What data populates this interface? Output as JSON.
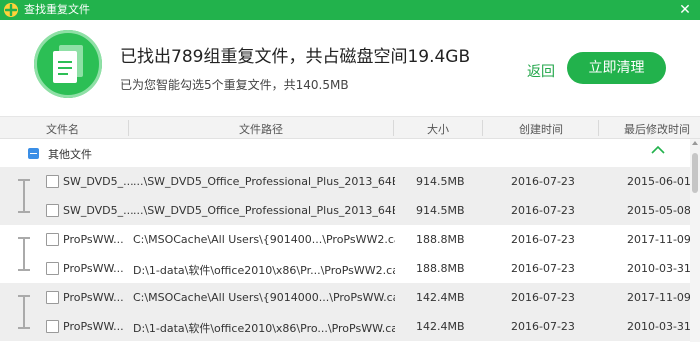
{
  "window": {
    "title": "查找重复文件",
    "close_glyph": "✕"
  },
  "header": {
    "headline": "已找出789组重复文件，共占磁盘空间19.4GB",
    "subline": "已为您智能勾选5个重复文件，共140.5MB",
    "back_label": "返回",
    "clean_label": "立即清理",
    "accent_color": "#22b24c"
  },
  "columns": [
    "文件名",
    "文件路径",
    "大小",
    "创建时间",
    "最后修改时间"
  ],
  "group": {
    "label": "其他文件",
    "collapse_icon": "chevron-up-icon"
  },
  "duplicate_groups": [
    {
      "rows": [
        {
          "name": "SW_DVD5_...",
          "path": "...\\SW_DVD5_Office_Professional_Plus_2013_64Bit_...",
          "size": "914.5MB",
          "created": "2016-07-23",
          "modified": "2015-06-01",
          "checked": false
        },
        {
          "name": "SW_DVD5_...",
          "path": "...\\SW_DVD5_Office_Professional_Plus_2013_64Bit_...",
          "size": "914.5MB",
          "created": "2016-07-23",
          "modified": "2015-05-08",
          "checked": false
        }
      ]
    },
    {
      "rows": [
        {
          "name": "ProPsWW...",
          "path": "C:\\MSOCache\\All Users\\{901400...\\ProPsWW2.cab",
          "size": "188.8MB",
          "created": "2016-07-23",
          "modified": "2017-11-09",
          "checked": false
        },
        {
          "name": "ProPsWW...",
          "path": "D:\\1-data\\软件\\office2010\\x86\\Pr...\\ProPsWW2.cab",
          "size": "188.8MB",
          "created": "2016-07-23",
          "modified": "2010-03-31",
          "checked": false
        }
      ]
    },
    {
      "rows": [
        {
          "name": "ProPsWW...",
          "path": "C:\\MSOCache\\All Users\\{9014000...\\ProPsWW.cab",
          "size": "142.4MB",
          "created": "2016-07-23",
          "modified": "2017-11-09",
          "checked": false
        },
        {
          "name": "ProPsWW...",
          "path": "D:\\1-data\\软件\\office2010\\x86\\Pro...\\ProPsWW.cab",
          "size": "142.4MB",
          "created": "2016-07-23",
          "modified": "2010-03-31",
          "checked": false
        }
      ]
    }
  ]
}
